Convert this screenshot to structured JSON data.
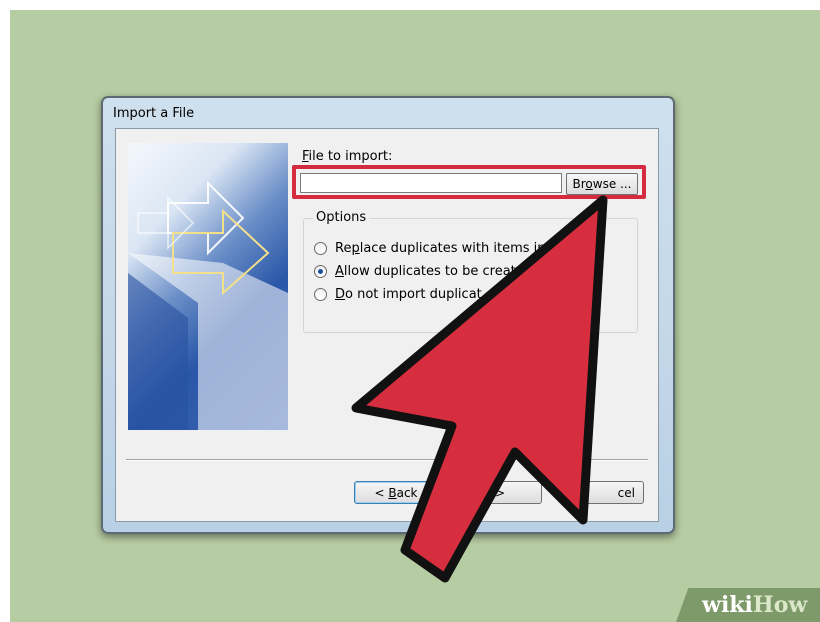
{
  "dialog": {
    "title": "Import a File",
    "file_label_access": "F",
    "file_label_rest": "ile to import:",
    "file_input_value": "",
    "browse_label_pre": "Br",
    "browse_label_access": "o",
    "browse_label_post": "wse ...",
    "options_legend": "Options",
    "radios": [
      {
        "pre": "Re",
        "access": "p",
        "post": "lace duplicates with items im",
        "checked": false
      },
      {
        "pre": "",
        "access": "A",
        "post": "llow duplicates to be creat",
        "checked": true
      },
      {
        "pre": "",
        "access": "D",
        "post": "o not import duplicat",
        "checked": false
      }
    ],
    "back_pre": "< ",
    "back_access": "B",
    "back_post": "ack",
    "next_label": ">",
    "cancel_label": "cel"
  },
  "watermark": {
    "part1": "wiki",
    "part2": "How"
  },
  "colors": {
    "background": "#b6cca2",
    "highlight": "#d42b40",
    "arrow_fill": "#d62e3e",
    "arrow_stroke": "#111111"
  }
}
